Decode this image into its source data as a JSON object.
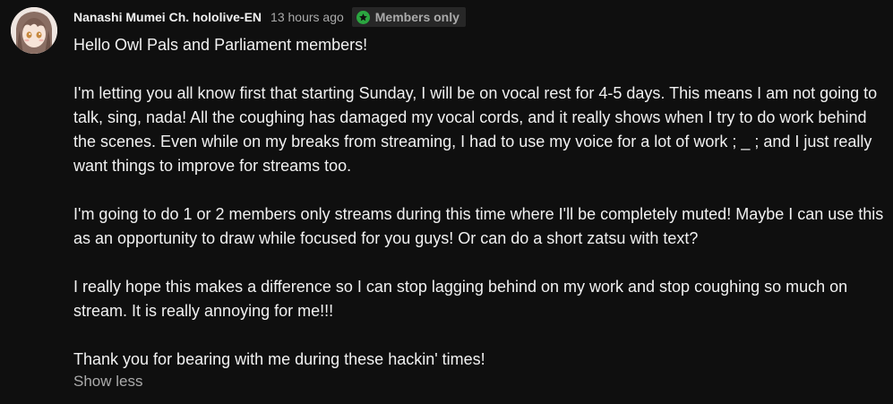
{
  "post": {
    "author": "Nanashi Mumei Ch. hololive-EN",
    "time": "13 hours ago",
    "badge_label": "Members only",
    "paragraphs": [
      "Hello Owl Pals and Parliament members!",
      "I'm letting you all know first that starting Sunday, I will be on vocal rest for 4-5 days. This means I am not going to talk, sing, nada! All the coughing has damaged my vocal cords, and it really shows when I try to do work behind the scenes. Even while on my breaks from streaming, I had to use my voice for a lot of work ; _ ; and I just really want things to improve for streams too.",
      "I'm going to do 1 or 2 members only streams during this time where I'll be completely muted! Maybe I can use this as an opportunity to draw while focused for you guys! Or can do a short zatsu with text?",
      "I really hope this makes a difference so I can stop lagging behind on my work and stop coughing so much on stream. It is really annoying for me!!!",
      "Thank you for bearing with me during these hackin' times!"
    ],
    "show_less_label": "Show less"
  },
  "icons": {
    "avatar": "channel-avatar",
    "badge": "star-badge-icon"
  },
  "colors": {
    "background": "#0f0f0f",
    "text": "#f1f1f1",
    "secondary_text": "#aaaaaa",
    "badge_bg": "#272727",
    "badge_icon": "#2ba640"
  }
}
